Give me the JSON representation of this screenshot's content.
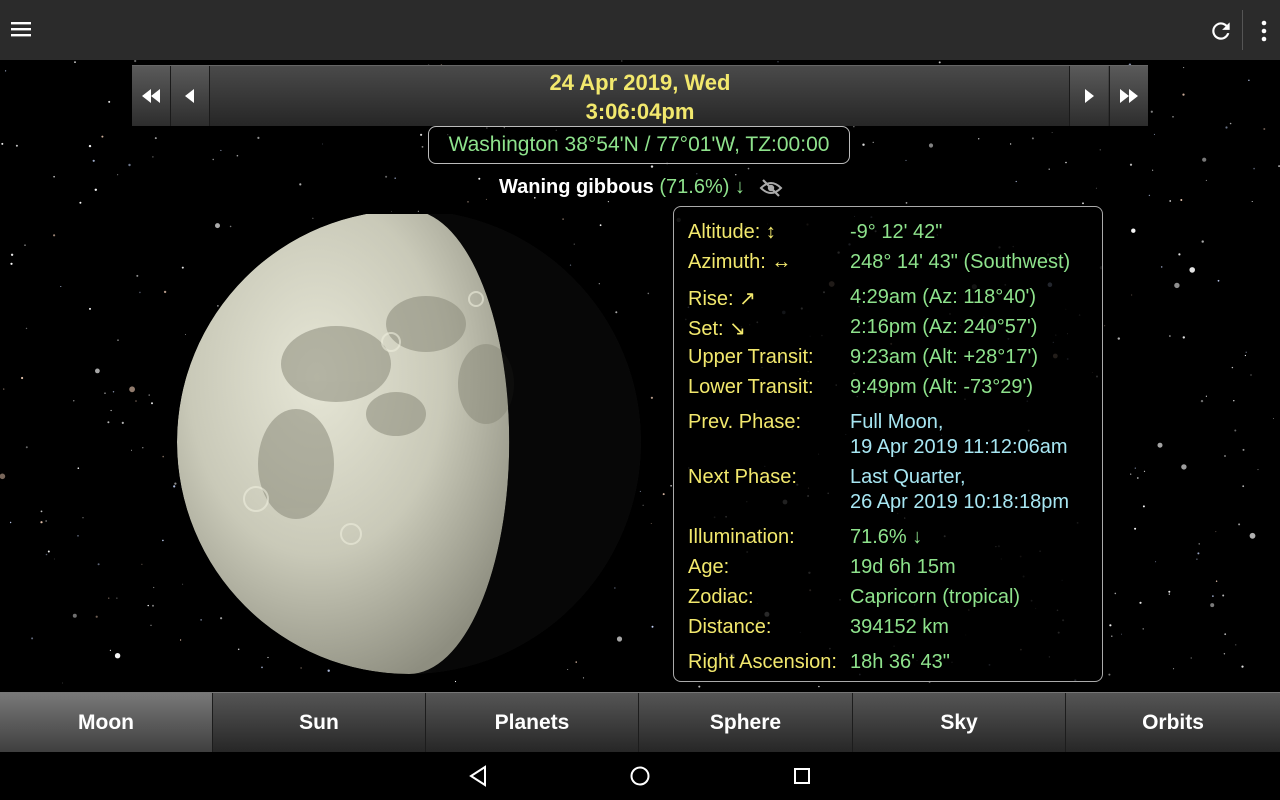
{
  "appbar": {
    "menu_icon": "hamburger-menu-icon",
    "refresh_icon": "refresh-icon",
    "overflow_icon": "more-vert-icon"
  },
  "datebar": {
    "date": "24 Apr 2019,  Wed",
    "time": "3:06:04pm",
    "buttons": [
      "fast-rewind-icon",
      "previous-icon",
      "next-icon",
      "fast-forward-icon"
    ]
  },
  "location": {
    "text": "Washington  38°54'N  /  77°01'W, TZ:00:00"
  },
  "phase": {
    "name": "Waning gibbous",
    "percent": " (71.6%) ↓",
    "illumination_fraction": 0.716,
    "eye_icon": "visibility-off-icon"
  },
  "info": {
    "rows": [
      {
        "label": "Altitude: ↕",
        "value": "-9° 12' 42\""
      },
      {
        "label": "Azimuth: ↔",
        "value": "248° 14' 43\" (Southwest)"
      },
      {
        "label": "Rise: ↗",
        "value": "4:29am (Az: 118°40')"
      },
      {
        "label": "Set: ↘",
        "value": "2:16pm (Az: 240°57')"
      },
      {
        "label": "Upper Transit:",
        "value": "9:23am (Alt: +28°17')"
      },
      {
        "label": "Lower Transit:",
        "value": "9:49pm (Alt: -73°29')"
      },
      {
        "label": "Prev. Phase:",
        "value": "Full Moon,",
        "value2": "19 Apr 2019  11:12:06am"
      },
      {
        "label": "Next Phase:",
        "value": "Last Quarter,",
        "value2": "26 Apr 2019  10:18:18pm"
      },
      {
        "label": "Illumination:",
        "value": "71.6% ↓"
      },
      {
        "label": "Age:",
        "value": "19d 6h 15m"
      },
      {
        "label": "Zodiac:",
        "value": "Capricorn (tropical)"
      },
      {
        "label": "Distance:",
        "value": "394152 km"
      },
      {
        "label": "Right Ascension:",
        "value": "18h 36' 43\""
      }
    ]
  },
  "tabs": [
    {
      "label": "Moon",
      "active": true
    },
    {
      "label": "Sun",
      "active": false
    },
    {
      "label": "Planets",
      "active": false
    },
    {
      "label": "Sphere",
      "active": false
    },
    {
      "label": "Sky",
      "active": false
    },
    {
      "label": "Orbits",
      "active": false
    }
  ],
  "sysnav": [
    "back-icon",
    "home-icon",
    "recents-icon"
  ]
}
